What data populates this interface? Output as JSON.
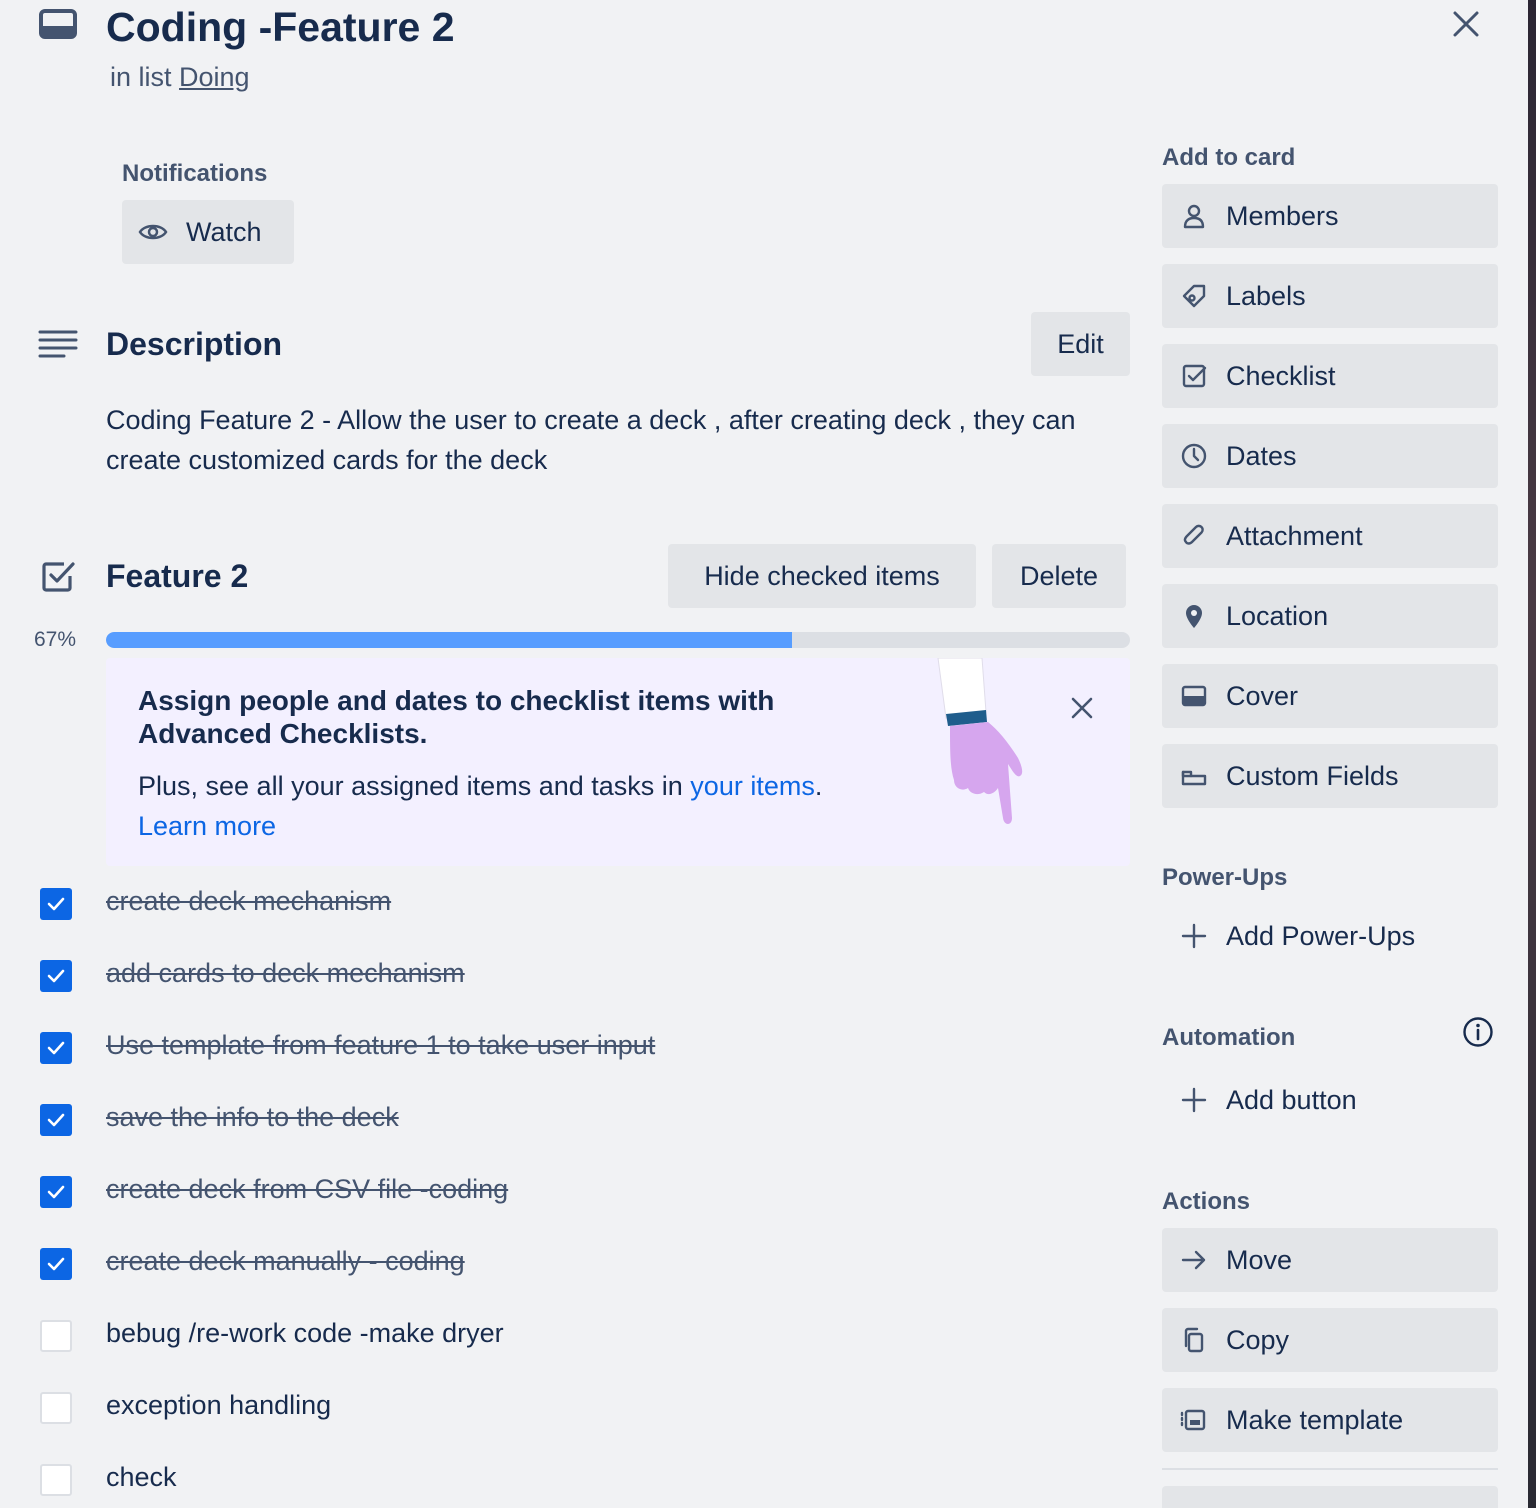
{
  "card": {
    "title": "Coding -Feature 2",
    "in_list_prefix": "in list",
    "list_name": "Doing"
  },
  "notifications": {
    "label": "Notifications",
    "watch_label": "Watch"
  },
  "description": {
    "heading": "Description",
    "edit_label": "Edit",
    "text": "Coding Feature 2 - Allow the user to create a deck , after creating deck , they can create customized cards for the deck"
  },
  "checklist": {
    "title": "Feature 2",
    "hide_checked_label": "Hide checked items",
    "delete_label": "Delete",
    "progress_percent_text": "67%",
    "progress": 0.67,
    "progress_color": "#579dff",
    "items": [
      {
        "text": "create deck mechanism",
        "checked": true
      },
      {
        "text": "add cards to deck mechanism",
        "checked": true
      },
      {
        "text": "Use template from feature 1 to take user input",
        "checked": true
      },
      {
        "text": "save the info to the deck",
        "checked": true
      },
      {
        "text": "create deck from CSV file -coding",
        "checked": true
      },
      {
        "text": "create deck manually - coding",
        "checked": true
      },
      {
        "text": "bebug /re-work code -make dryer",
        "checked": false
      },
      {
        "text": "exception handling",
        "checked": false
      },
      {
        "text": "check",
        "checked": false
      }
    ]
  },
  "promo": {
    "title": "Assign people and dates to checklist items with Advanced Checklists.",
    "body_prefix": "Plus, see all your assigned items and tasks in",
    "your_items_link": "your items",
    "body_suffix": ".",
    "learn_more": "Learn more",
    "link_color": "#0c66e4",
    "background": "#f3f0ff"
  },
  "sidebar": {
    "add_to_card_label": "Add to card",
    "add_to_card": [
      {
        "label": "Members",
        "icon": "person-icon"
      },
      {
        "label": "Labels",
        "icon": "tag-icon"
      },
      {
        "label": "Checklist",
        "icon": "checkbox-icon"
      },
      {
        "label": "Dates",
        "icon": "clock-icon"
      },
      {
        "label": "Attachment",
        "icon": "paperclip-icon"
      },
      {
        "label": "Location",
        "icon": "location-pin-icon"
      },
      {
        "label": "Cover",
        "icon": "cover-icon"
      },
      {
        "label": "Custom Fields",
        "icon": "custom-fields-icon"
      }
    ],
    "power_ups_label": "Power-Ups",
    "add_power_ups_label": "Add Power-Ups",
    "automation_label": "Automation",
    "add_button_label": "Add button",
    "actions_label": "Actions",
    "actions": [
      {
        "label": "Move",
        "icon": "arrow-right-icon"
      },
      {
        "label": "Copy",
        "icon": "copy-icon"
      },
      {
        "label": "Make template",
        "icon": "template-icon"
      }
    ]
  },
  "colors": {
    "checkbox_checked": "#0c66e4",
    "button_bg": "#e3e5e8",
    "page_bg": "#f1f2f4"
  }
}
